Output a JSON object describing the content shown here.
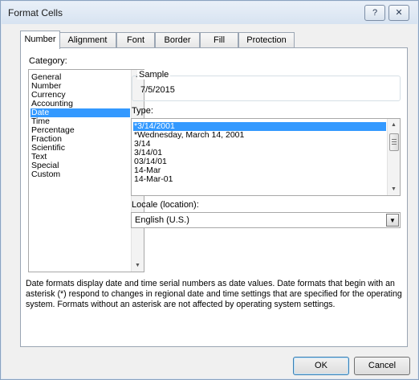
{
  "window": {
    "title": "Format Cells",
    "help_glyph": "?",
    "close_glyph": "✕"
  },
  "tabs": [
    {
      "label": "Number",
      "active": true
    },
    {
      "label": "Alignment",
      "active": false
    },
    {
      "label": "Font",
      "active": false
    },
    {
      "label": "Border",
      "active": false
    },
    {
      "label": "Fill",
      "active": false
    },
    {
      "label": "Protection",
      "active": false
    }
  ],
  "category": {
    "label": "Category:",
    "items": [
      "General",
      "Number",
      "Currency",
      "Accounting",
      "Date",
      "Time",
      "Percentage",
      "Fraction",
      "Scientific",
      "Text",
      "Special",
      "Custom"
    ],
    "selected": "Date"
  },
  "sample": {
    "label": "Sample",
    "value": "7/5/2015"
  },
  "type": {
    "label": "Type:",
    "items": [
      "*3/14/2001",
      "*Wednesday, March 14, 2001",
      "3/14",
      "3/14/01",
      "03/14/01",
      "14-Mar",
      "14-Mar-01"
    ],
    "selected": "*3/14/2001"
  },
  "locale": {
    "label": "Locale (location):",
    "value": "English (U.S.)"
  },
  "description": "Date formats display date and time serial numbers as date values.  Date formats that begin with an asterisk (*) respond to changes in regional date and time settings that are specified for the operating system. Formats without an asterisk are not affected by operating system settings.",
  "buttons": {
    "ok": "OK",
    "cancel": "Cancel"
  },
  "colors": {
    "selection": "#3399ff",
    "dialog_bg": "#f0f0f0"
  }
}
